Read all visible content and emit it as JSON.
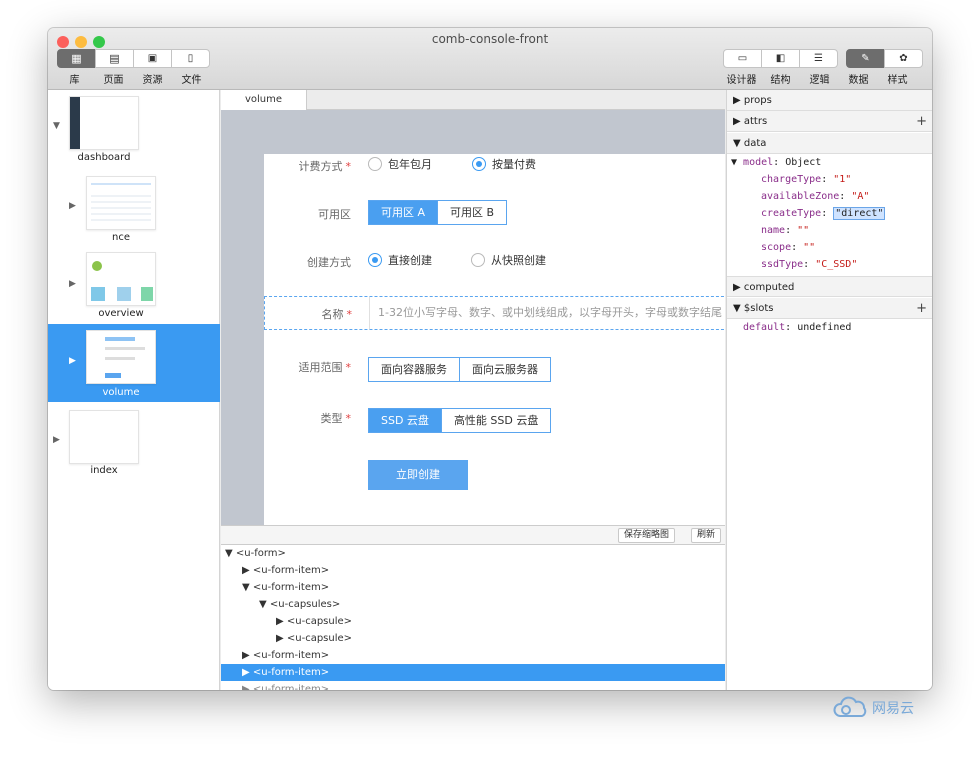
{
  "window": {
    "title": "comb-console-front",
    "lights": [
      "#fc605c",
      "#fdbc40",
      "#34c84a"
    ]
  },
  "toolbar_left": [
    {
      "label": "库",
      "icon": "library-icon"
    },
    {
      "label": "页面",
      "icon": "page-layout-icon"
    },
    {
      "label": "资源",
      "icon": "image-icon"
    },
    {
      "label": "文件",
      "icon": "file-icon"
    }
  ],
  "toolbar_right": [
    {
      "label": "设计器",
      "icon": "designer-icon"
    },
    {
      "label": "结构",
      "icon": "structure-icon"
    },
    {
      "label": "逻辑",
      "icon": "logic-icon"
    },
    {
      "label": "数据",
      "icon": "data-icon"
    },
    {
      "label": "样式",
      "icon": "palette-icon"
    }
  ],
  "pages": [
    {
      "label": "dashboard",
      "expanded": true
    },
    {
      "label": "nce"
    },
    {
      "label": "overview"
    },
    {
      "label": "volume",
      "selected": true
    },
    {
      "label": "index"
    }
  ],
  "editor": {
    "tab": "volume"
  },
  "form": {
    "charge_label": "计费方式",
    "charge_options": [
      "包年包月",
      "按量付费"
    ],
    "zone_label": "可用区",
    "zone_options": [
      "可用区 A",
      "可用区 B"
    ],
    "create_label": "创建方式",
    "create_options": [
      "直接创建",
      "从快照创建"
    ],
    "name_label": "名称",
    "name_placeholder": "1-32位小写字母、数字、或中划线组成，以字母开头，字母或数字结尾",
    "scope_label": "适用范围",
    "scope_options": [
      "面向容器服务",
      "面向云服务器"
    ],
    "type_label": "类型",
    "type_options": [
      "SSD 云盘",
      "高性能 SSD 云盘"
    ],
    "submit": "立即创建",
    "required_mark": "*"
  },
  "canvas_toolbar": {
    "save_thumb": "保存缩略图",
    "refresh": "刷新"
  },
  "tree": [
    {
      "text": "▼ <u-form>",
      "indent": 0
    },
    {
      "text": "▶ <u-form-item>",
      "indent": 1
    },
    {
      "text": "▼ <u-form-item>",
      "indent": 1
    },
    {
      "text": "▼ <u-capsules>",
      "indent": 2
    },
    {
      "text": "▶ <u-capsule>",
      "indent": 3
    },
    {
      "text": "▶ <u-capsule>",
      "indent": 3
    },
    {
      "text": "▶ <u-form-item>",
      "indent": 1
    },
    {
      "text": "▶ <u-form-item>",
      "indent": 1,
      "selected": true
    },
    {
      "text": "▶ <u-form-item>",
      "indent": 1
    }
  ],
  "inspector": {
    "props": "props",
    "attrs": "attrs",
    "data": "data",
    "model_key": "model",
    "model_type": "Object",
    "fields": [
      {
        "key": "chargeType",
        "value": "\"1\""
      },
      {
        "key": "availableZone",
        "value": "\"A\""
      },
      {
        "key": "createType",
        "value": "\"direct\"",
        "editing": true
      },
      {
        "key": "name",
        "value": "\"\""
      },
      {
        "key": "scope",
        "value": "\"\""
      },
      {
        "key": "ssdType",
        "value": "\"C_SSD\""
      }
    ],
    "computed": "computed",
    "slots": "$slots",
    "slot_key": "default",
    "slot_value": "undefined"
  },
  "brand": {
    "text": "网易云"
  }
}
